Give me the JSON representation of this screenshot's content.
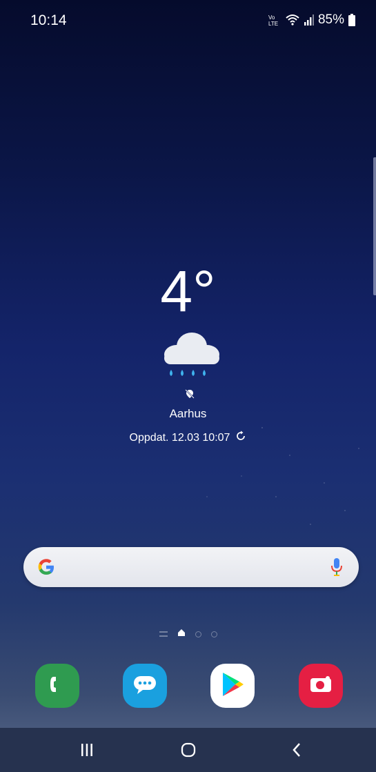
{
  "status_bar": {
    "time": "10:14",
    "volte_label": "VoLTE",
    "battery": "85%"
  },
  "weather": {
    "temperature": "4°",
    "condition_icon": "rain-cloud-icon",
    "city": "Aarhus",
    "updated": "Oppdat. 12.03 10:07"
  },
  "search": {
    "provider_icon": "google-g-icon",
    "mic_icon": "microphone-icon"
  },
  "pages": {
    "count": 3,
    "active": 0
  },
  "dock": {
    "apps": [
      {
        "name": "Phone",
        "icon": "phone-icon",
        "color": "#2f9b50"
      },
      {
        "name": "Messages",
        "icon": "messages-icon",
        "color": "#1aa0df"
      },
      {
        "name": "Play Store",
        "icon": "play-store-icon",
        "color": "#ffffff"
      },
      {
        "name": "Camera",
        "icon": "camera-icon",
        "color": "#e51f43"
      }
    ]
  },
  "navigation": {
    "recents": "recents-icon",
    "home": "home-icon",
    "back": "back-icon"
  }
}
